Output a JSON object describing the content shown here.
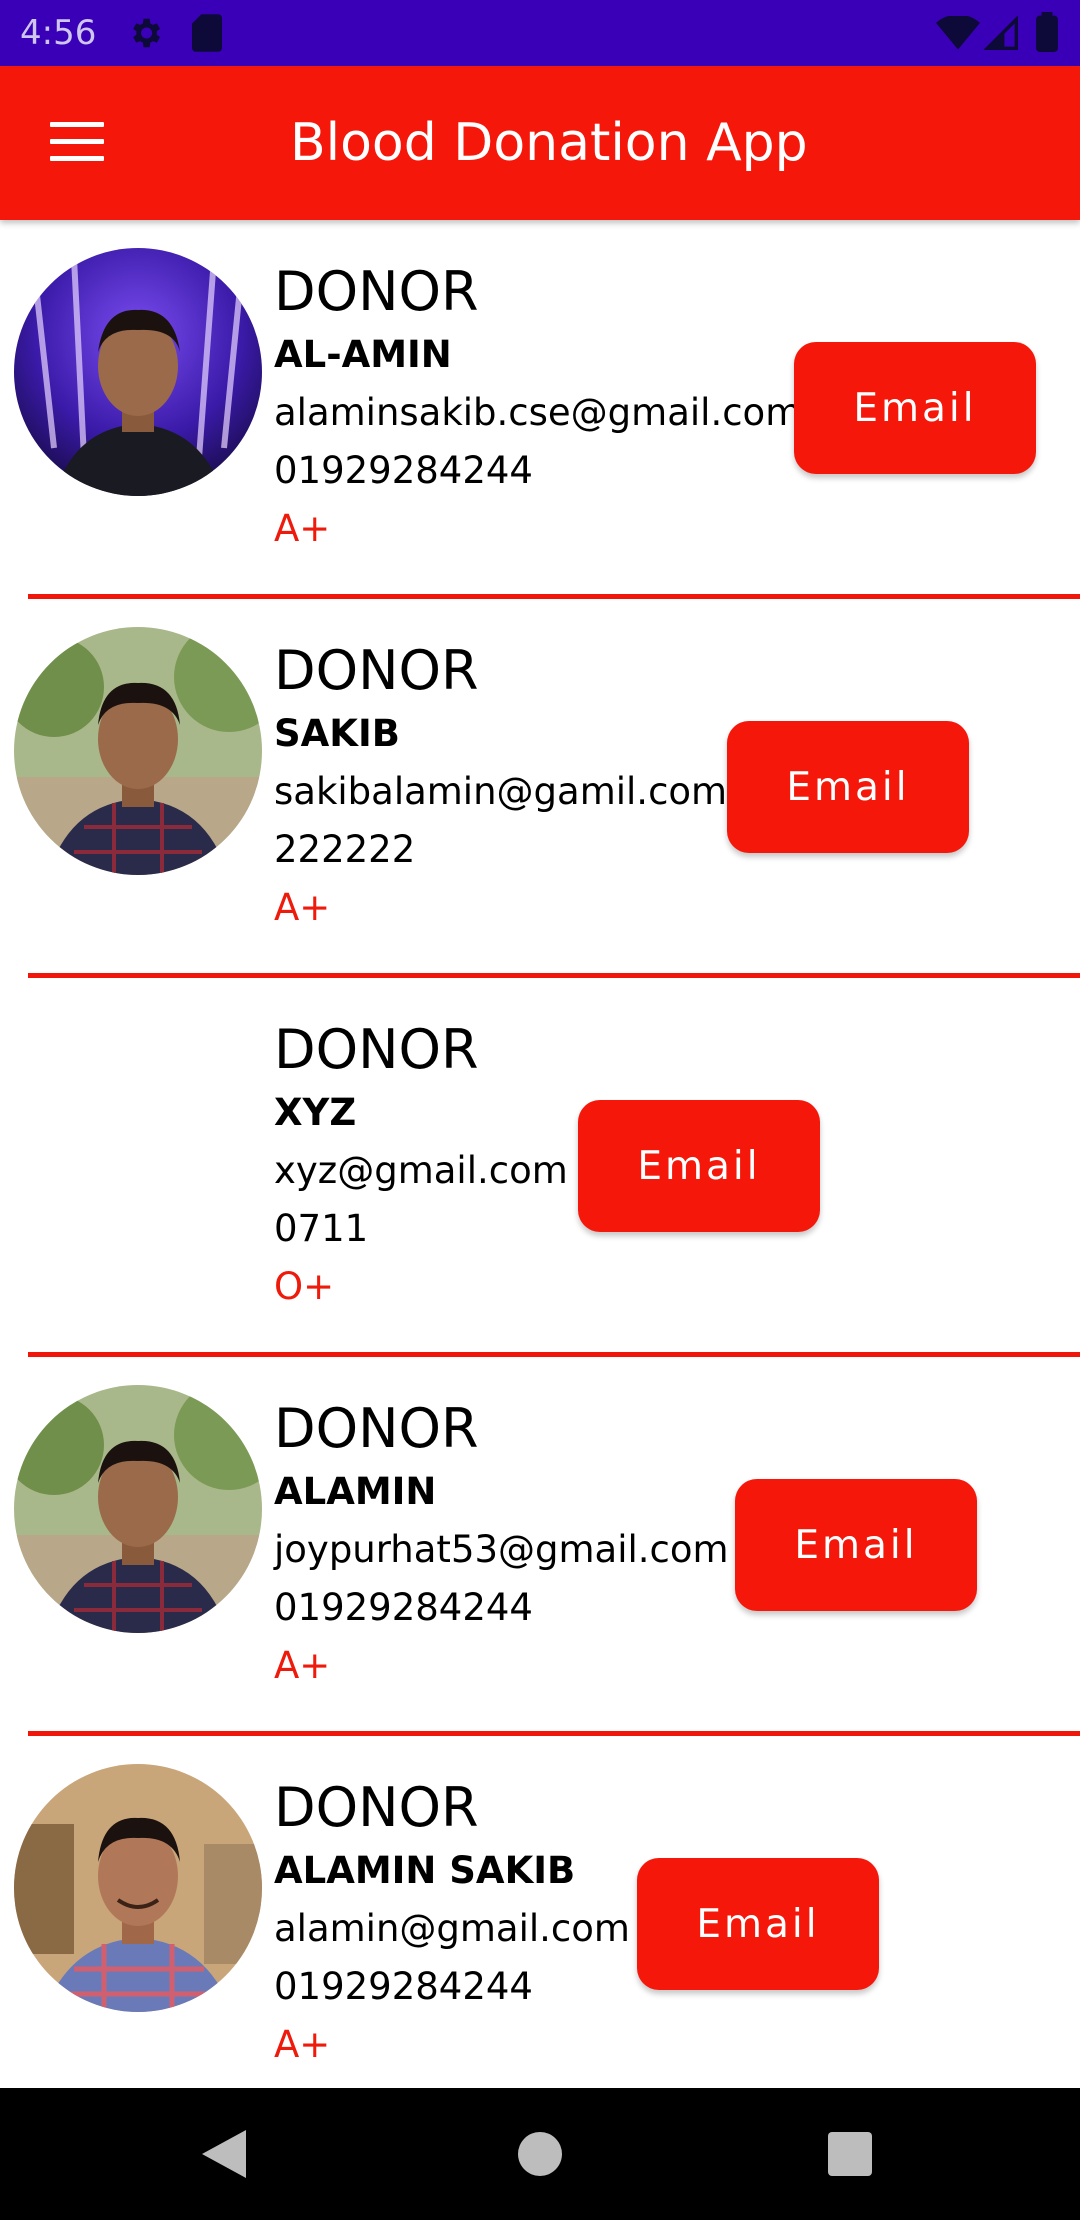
{
  "status_bar": {
    "time": "4:56",
    "icons": [
      "gear-icon",
      "sd-card-icon",
      "wifi-icon",
      "signal-icon",
      "battery-icon"
    ],
    "background": "#3a00b8"
  },
  "app_bar": {
    "title": "Blood Donation App",
    "menu_icon": "menu-icon",
    "background": "#f5170a"
  },
  "donors": [
    {
      "label": "DONOR",
      "name": "AL-AMIN",
      "email": "alaminsakib.cse@gmail.com",
      "phone": "01929284244",
      "blood_group": "A+",
      "button": "Email",
      "has_photo": true
    },
    {
      "label": "DONOR",
      "name": "SAKIB",
      "email": "sakibalamin@gamil.com",
      "phone": "222222",
      "blood_group": "A+",
      "button": "Email",
      "has_photo": true
    },
    {
      "label": "DONOR",
      "name": "XYZ",
      "email": "xyz@gmail.com",
      "phone": "0711",
      "blood_group": "O+",
      "button": "Email",
      "has_photo": false
    },
    {
      "label": "DONOR",
      "name": "ALAMIN",
      "email": "joypurhat53@gmail.com",
      "phone": "01929284244",
      "blood_group": "A+",
      "button": "Email",
      "has_photo": true
    },
    {
      "label": "DONOR",
      "name": "ALAMIN SAKIB",
      "email": "alamin@gmail.com",
      "phone": "01929284244",
      "blood_group": "A+",
      "button": "Email",
      "has_photo": true
    }
  ],
  "nav_bar": {
    "icons": [
      "back-icon",
      "home-icon",
      "recent-apps-icon"
    ]
  },
  "colors": {
    "accent": "#f5170a",
    "blood_group_text": "#ee1b0c",
    "divider": "#f0160a"
  }
}
